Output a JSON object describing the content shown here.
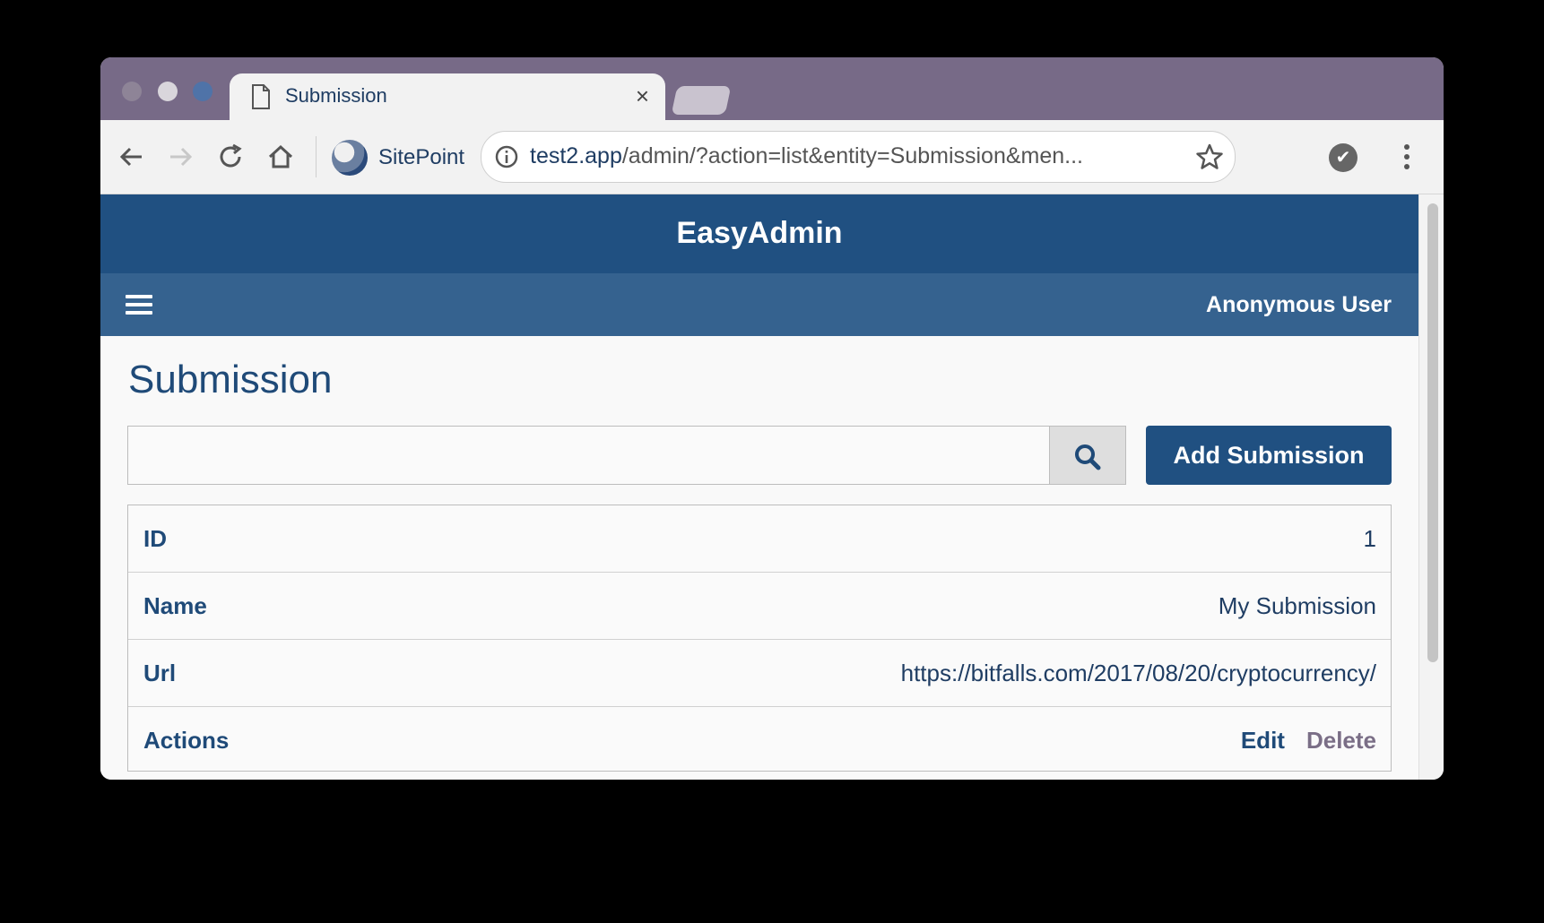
{
  "browser": {
    "tab_title": "Submission",
    "tab_close": "×",
    "bookmark_label": "SitePoint",
    "url_host": "test2.app",
    "url_path": "/admin/?action=list&entity=Submission&men..."
  },
  "app": {
    "brand": "EasyAdmin",
    "user_name": "Anonymous User"
  },
  "page": {
    "title": "Submission",
    "search": {
      "value": "",
      "placeholder": ""
    },
    "add_button_label": "Add Submission"
  },
  "record": {
    "rows": [
      {
        "label": "ID",
        "value": "1"
      },
      {
        "label": "Name",
        "value": "My Submission"
      },
      {
        "label": "Url",
        "value": "https://bitfalls.com/2017/08/20/cryptocurrency/"
      }
    ],
    "actions_label": "Actions",
    "edit_label": "Edit",
    "delete_label": "Delete"
  },
  "colors": {
    "brand_blue": "#205081",
    "nav_blue": "#35628f",
    "tab_strip": "#776a87"
  }
}
